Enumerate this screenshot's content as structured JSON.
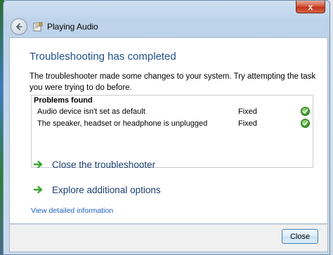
{
  "window": {
    "title": "Playing Audio",
    "close_glyph": "x"
  },
  "main": {
    "heading": "Troubleshooting has completed",
    "description": "The troubleshooter made some changes to your system. Try attempting the task you were trying to do before.",
    "problems_title": "Problems found",
    "problems": [
      {
        "description": "Audio device isn't set as default",
        "status": "Fixed",
        "icon": "green-check-icon"
      },
      {
        "description": "The speaker, headset or headphone is unplugged",
        "status": "Fixed",
        "icon": "green-check-icon"
      }
    ],
    "actions": [
      {
        "label": "Close the troubleshooter",
        "icon": "green-arrow-icon"
      },
      {
        "label": "Explore additional options",
        "icon": "green-arrow-icon"
      }
    ],
    "details_link": "View detailed information"
  },
  "footer": {
    "close_label": "Close"
  },
  "colors": {
    "heading": "#1f4f8a",
    "link": "#1f5fbf",
    "success": "#3ea22b"
  }
}
